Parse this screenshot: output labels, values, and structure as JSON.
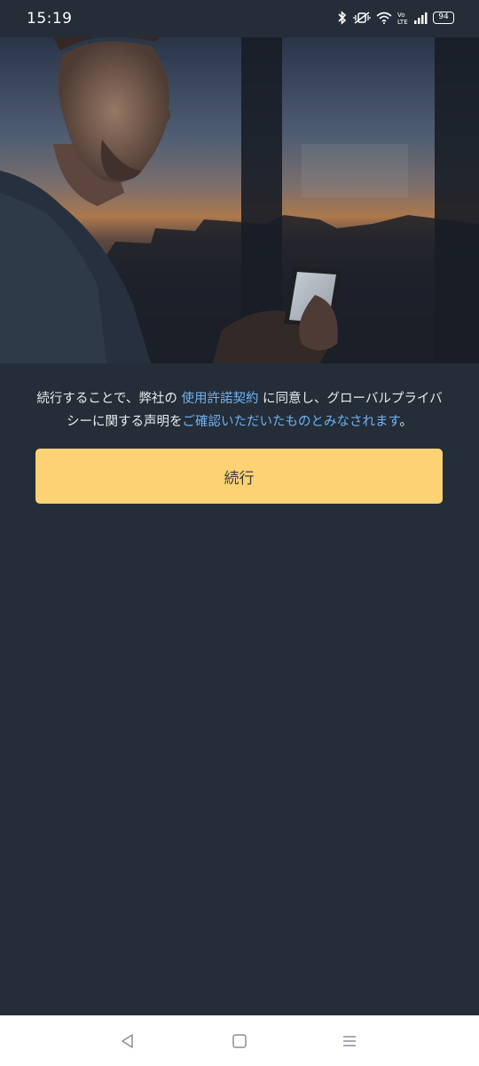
{
  "status_bar": {
    "time": "15:19",
    "battery": "94",
    "icons": [
      "bluetooth-icon",
      "mute-vibrate-icon",
      "wifi-icon",
      "volte-icon",
      "signal-icon",
      "battery-icon"
    ]
  },
  "hero": {
    "image": "man-looking-at-phone-by-window-at-dusk"
  },
  "consent": {
    "text_before": "続行することで、弊社の ",
    "eula_link": "使用許諾契約",
    "text_middle": " に同意し、グローバルプライバシーに関する声明を",
    "privacy_link": "ご確認いただいたものとみなされます",
    "text_end": "。"
  },
  "continue_button": {
    "label": "続行"
  },
  "nav_bar": {
    "icons": [
      "back-icon",
      "home-icon",
      "recents-icon"
    ]
  },
  "colors": {
    "background": "#252d38",
    "accent_button": "#fcd274",
    "link": "#6fb3f2",
    "text": "#e8ebef"
  }
}
